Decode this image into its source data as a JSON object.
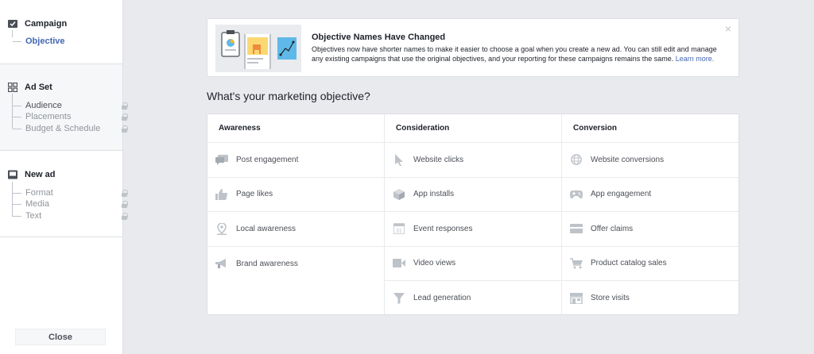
{
  "sidebar": {
    "campaign": {
      "title": "Campaign",
      "items": [
        {
          "label": "Objective"
        }
      ]
    },
    "adset": {
      "title": "Ad Set",
      "items": [
        {
          "label": "Audience"
        },
        {
          "label": "Placements"
        },
        {
          "label": "Budget & Schedule"
        }
      ]
    },
    "newad": {
      "title": "New ad",
      "items": [
        {
          "label": "Format"
        },
        {
          "label": "Media"
        },
        {
          "label": "Text"
        }
      ]
    },
    "close_label": "Close"
  },
  "banner": {
    "title": "Objective Names Have Changed",
    "body": "Objectives now have shorter names to make it easier to choose a goal when you create a new ad. You can still edit and manage any existing campaigns that use the original objectives, and your reporting for these campaigns remains the same.",
    "link": "Learn more.",
    "close": "×"
  },
  "question": "What's your marketing objective?",
  "columns": [
    {
      "title": "Awareness",
      "items": [
        {
          "label": "Post engagement",
          "icon": "speech-bubbles-icon"
        },
        {
          "label": "Page likes",
          "icon": "thumbs-up-icon"
        },
        {
          "label": "Local awareness",
          "icon": "map-pin-icon"
        },
        {
          "label": "Brand awareness",
          "icon": "megaphone-icon"
        }
      ]
    },
    {
      "title": "Consideration",
      "items": [
        {
          "label": "Website clicks",
          "icon": "cursor-icon"
        },
        {
          "label": "App installs",
          "icon": "box-icon"
        },
        {
          "label": "Event responses",
          "icon": "calendar-icon"
        },
        {
          "label": "Video views",
          "icon": "video-camera-icon"
        },
        {
          "label": "Lead generation",
          "icon": "funnel-icon"
        }
      ]
    },
    {
      "title": "Conversion",
      "items": [
        {
          "label": "Website conversions",
          "icon": "globe-icon"
        },
        {
          "label": "App engagement",
          "icon": "gamepad-icon"
        },
        {
          "label": "Offer claims",
          "icon": "coupon-icon"
        },
        {
          "label": "Product catalog sales",
          "icon": "shopping-cart-icon"
        },
        {
          "label": "Store visits",
          "icon": "store-icon"
        }
      ]
    }
  ],
  "colors": {
    "accent": "#4267b2",
    "icon": "#bec3c9",
    "border": "#dddfe2",
    "background": "#e9eaed"
  }
}
